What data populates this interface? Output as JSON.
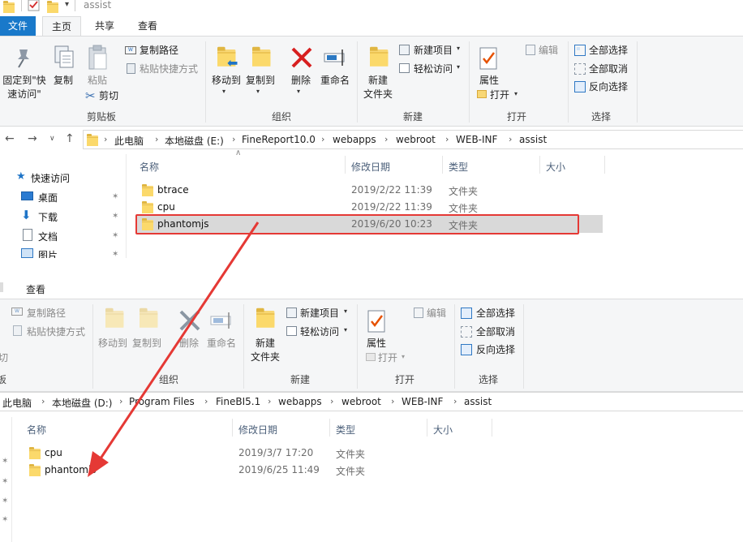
{
  "top_window": {
    "title": "assist",
    "tabs": [
      "文件",
      "主页",
      "共享",
      "查看"
    ],
    "ribbon": {
      "clipboard": {
        "pin_quick_access": "固定到\"快\n速访问\"",
        "copy": "复制",
        "paste": "粘贴",
        "copy_path": "复制路径",
        "paste_shortcut": "粘贴快捷方式",
        "cut": "剪切",
        "group": "剪贴板"
      },
      "organize": {
        "move_to": "移动到",
        "copy_to": "复制到",
        "delete": "删除",
        "rename": "重命名",
        "group": "组织"
      },
      "new": {
        "new_folder": "新建\n文件夹",
        "new_item": "新建项目",
        "easy_access": "轻松访问",
        "group": "新建"
      },
      "open": {
        "properties": "属性",
        "open": "打开",
        "edit": "编辑",
        "group": "打开"
      },
      "select": {
        "select_all": "全部选择",
        "select_none": "全部取消",
        "invert": "反向选择",
        "group": "选择"
      }
    },
    "breadcrumb": [
      "此电脑",
      "本地磁盘 (E:)",
      "FineReport10.0",
      "webapps",
      "webroot",
      "WEB-INF",
      "assist"
    ],
    "columns": [
      "名称",
      "修改日期",
      "类型",
      "大小"
    ],
    "nav": [
      "快速访问",
      "桌面",
      "下载",
      "文档",
      "图片"
    ],
    "files": [
      {
        "name": "btrace",
        "date": "2019/2/22 11:39",
        "type": "文件夹"
      },
      {
        "name": "cpu",
        "date": "2019/2/22 11:39",
        "type": "文件夹"
      },
      {
        "name": "phantomjs",
        "date": "2019/6/20 10:23",
        "type": "文件夹"
      }
    ]
  },
  "bottom_window": {
    "tabs": [
      "查看"
    ],
    "ribbon": {
      "copy_path": "复制路径",
      "paste_shortcut": "粘贴快捷方式",
      "cut_partial": "切",
      "clipboard_partial": "板",
      "move_to": "移动到",
      "copy_to": "复制到",
      "delete": "删除",
      "rename": "重命名",
      "organize_group": "组织",
      "new_folder": "新建\n文件夹",
      "new_item": "新建项目",
      "easy_access": "轻松访问",
      "new_group": "新建",
      "properties": "属性",
      "open": "打开",
      "edit": "编辑",
      "open_group": "打开",
      "select_all": "全部选择",
      "select_none": "全部取消",
      "invert": "反向选择",
      "select_group": "选择"
    },
    "breadcrumb": [
      "此电脑",
      "本地磁盘 (D:)",
      "Program Files",
      "FineBI5.1",
      "webapps",
      "webroot",
      "WEB-INF",
      "assist"
    ],
    "columns": [
      "名称",
      "修改日期",
      "类型",
      "大小"
    ],
    "files": [
      {
        "name": "cpu",
        "date": "2019/3/7 17:20",
        "type": "文件夹"
      },
      {
        "name": "phantomjs",
        "date": "2019/6/25 11:49",
        "type": "文件夹"
      }
    ]
  },
  "colors": {
    "file_tab": "#1979ca",
    "highlight_box": "#e53935",
    "arrow": "#e53935",
    "selected_row": "#d9d9d9",
    "folder": "#f8d775"
  }
}
